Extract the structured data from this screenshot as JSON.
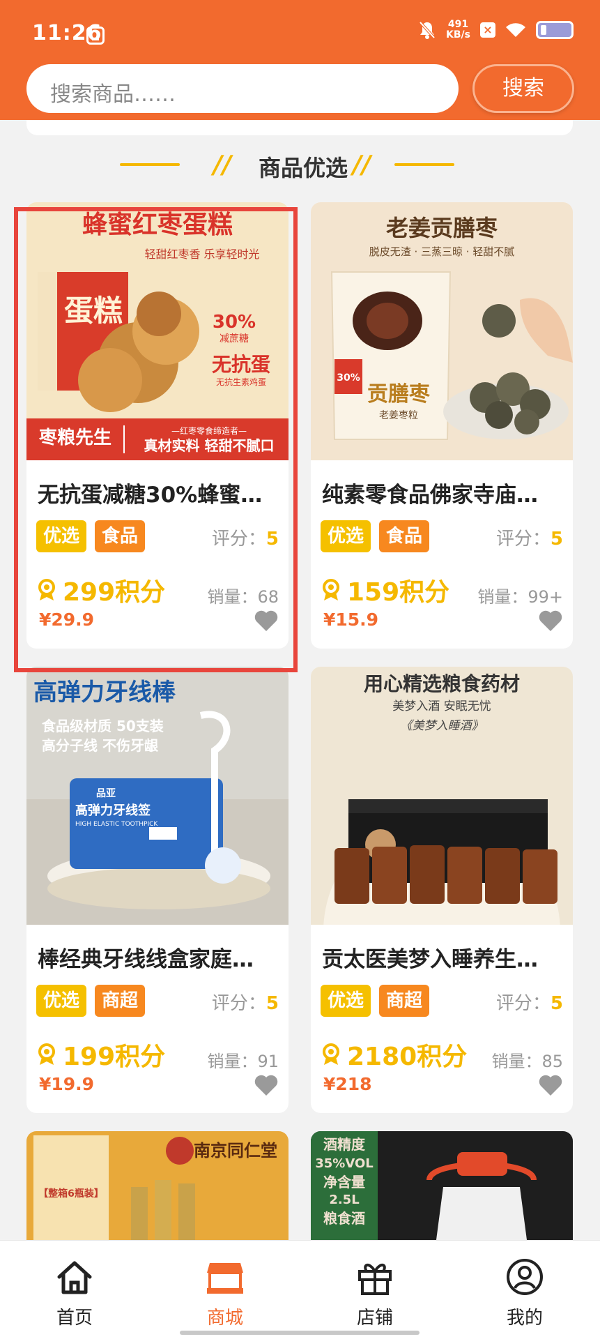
{
  "status_bar": {
    "time": "11:26",
    "speed_value": "491",
    "speed_unit": "KB/s"
  },
  "search": {
    "placeholder": "搜索商品……",
    "button_label": "搜索"
  },
  "section": {
    "title": "商品优选",
    "slash": "//"
  },
  "products": [
    {
      "title": "无抗蛋减糖30%蜂蜜…",
      "tags": [
        "优选",
        "食品"
      ],
      "rating_label": "评分：",
      "rating": "5",
      "points": "299积分",
      "sales_label": "销量：",
      "sales": "68",
      "price": "¥29.9",
      "image": {
        "headline": "蜂蜜红枣蛋糕",
        "subline": "轻甜红枣香 乐享轻时光",
        "box_text": "蛋糕",
        "badge_pct": "30%",
        "badge_text": "减蔗糖",
        "claim": "无抗蛋",
        "claim_sub": "无抗生素鸡蛋",
        "brand": "枣粮先生",
        "slogan_top": "—红枣零食缔造者—",
        "slogan": "真材实料 轻甜不腻口"
      }
    },
    {
      "title": "纯素零食品佛家寺庙…",
      "tags": [
        "优选",
        "食品"
      ],
      "rating_label": "评分：",
      "rating": "5",
      "points": "159积分",
      "sales_label": "销量：",
      "sales": "99+",
      "price": "¥15.9",
      "image": {
        "headline": "老姜贡膳枣",
        "subline": "脱皮无渣 · 三蒸三晾 · 轻甜不腻",
        "bag_text": "贡膳枣",
        "bag_sub": "老姜枣粒",
        "bag_pct": "30%"
      }
    },
    {
      "title": "棒经典牙线线盒家庭…",
      "tags": [
        "优选",
        "商超"
      ],
      "rating_label": "评分：",
      "rating": "5",
      "points": "199积分",
      "sales_label": "销量：",
      "sales": "91",
      "price": "¥19.9",
      "image": {
        "headline": "高弹力牙线棒",
        "line1": "食品级材质 50支装",
        "line2": "高分子线 不伤牙龈",
        "box_brand": "品亚",
        "box_title": "高弹力牙线签",
        "box_en": "HIGH ELASTIC TOOTHPICK"
      }
    },
    {
      "title": "贡太医美梦入睡养生…",
      "tags": [
        "优选",
        "商超"
      ],
      "rating_label": "评分：",
      "rating": "5",
      "points": "2180积分",
      "sales_label": "销量：",
      "sales": "85",
      "price": "¥218",
      "image": {
        "headline": "用心精选粮食药材",
        "line1": "美梦入酒 安眠无忧",
        "line2": "《美梦入睡酒》"
      }
    }
  ],
  "partial_products": [
    {
      "box_label": "【整箱6瓶装】",
      "brand": "南京同仁堂"
    },
    {
      "lines": [
        "酒精度",
        "35%VOL",
        "净含量",
        "2.5L",
        "粮食酒"
      ]
    }
  ],
  "bottom_nav": [
    {
      "label": "首页",
      "icon": "home-icon"
    },
    {
      "label": "商城",
      "icon": "shop-icon"
    },
    {
      "label": "店铺",
      "icon": "gift-icon"
    },
    {
      "label": "我的",
      "icon": "user-icon"
    }
  ],
  "colors": {
    "brand_orange": "#f26a2e",
    "accent_yellow": "#f5b800",
    "tag_orange": "#f7881f",
    "highlight_red": "#e8453c"
  }
}
